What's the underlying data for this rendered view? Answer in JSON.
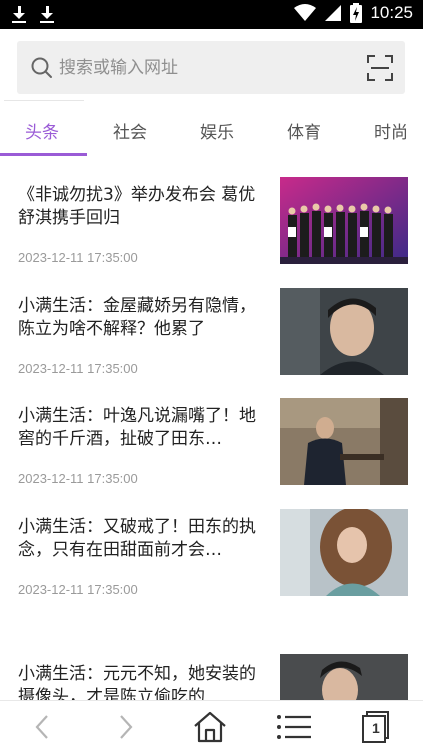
{
  "status_bar": {
    "time": "10:25",
    "icons": [
      "download-icon",
      "download-icon",
      "wifi-icon",
      "signal-icon",
      "battery-charging-icon"
    ]
  },
  "search": {
    "placeholder": "搜索或输入网址",
    "icon": "search-icon",
    "scan_icon": "scan-icon"
  },
  "tabs": [
    {
      "label": "头条",
      "active": true
    },
    {
      "label": "社会",
      "active": false
    },
    {
      "label": "娱乐",
      "active": false
    },
    {
      "label": "体育",
      "active": false
    },
    {
      "label": "时尚",
      "active": false
    }
  ],
  "accent_color": "#9a5bd6",
  "news": [
    {
      "title": "《非诚勿扰3》举办发布会 葛优舒淇携手回归",
      "time": "2023-12-11 17:35:00"
    },
    {
      "title": "小满生活：金屋藏娇另有隐情，陈立为啥不解释？他累了",
      "time": "2023-12-11 17:35:00"
    },
    {
      "title": "小满生活：叶逸凡说漏嘴了！地窖的千斤酒，扯破了田东…",
      "time": "2023-12-11 17:35:00"
    },
    {
      "title": "小满生活：又破戒了！田东的执念，只有在田甜面前才会…",
      "time": "2023-12-11 17:35:00"
    },
    {
      "title": "小满生活：元元不知，她安装的摄像头，才是陈立偷吃的",
      "time": ""
    }
  ],
  "bottom_nav": {
    "tab_count": "1",
    "icons": [
      "back-icon",
      "forward-icon",
      "home-icon",
      "menu-icon",
      "tabs-icon"
    ]
  }
}
